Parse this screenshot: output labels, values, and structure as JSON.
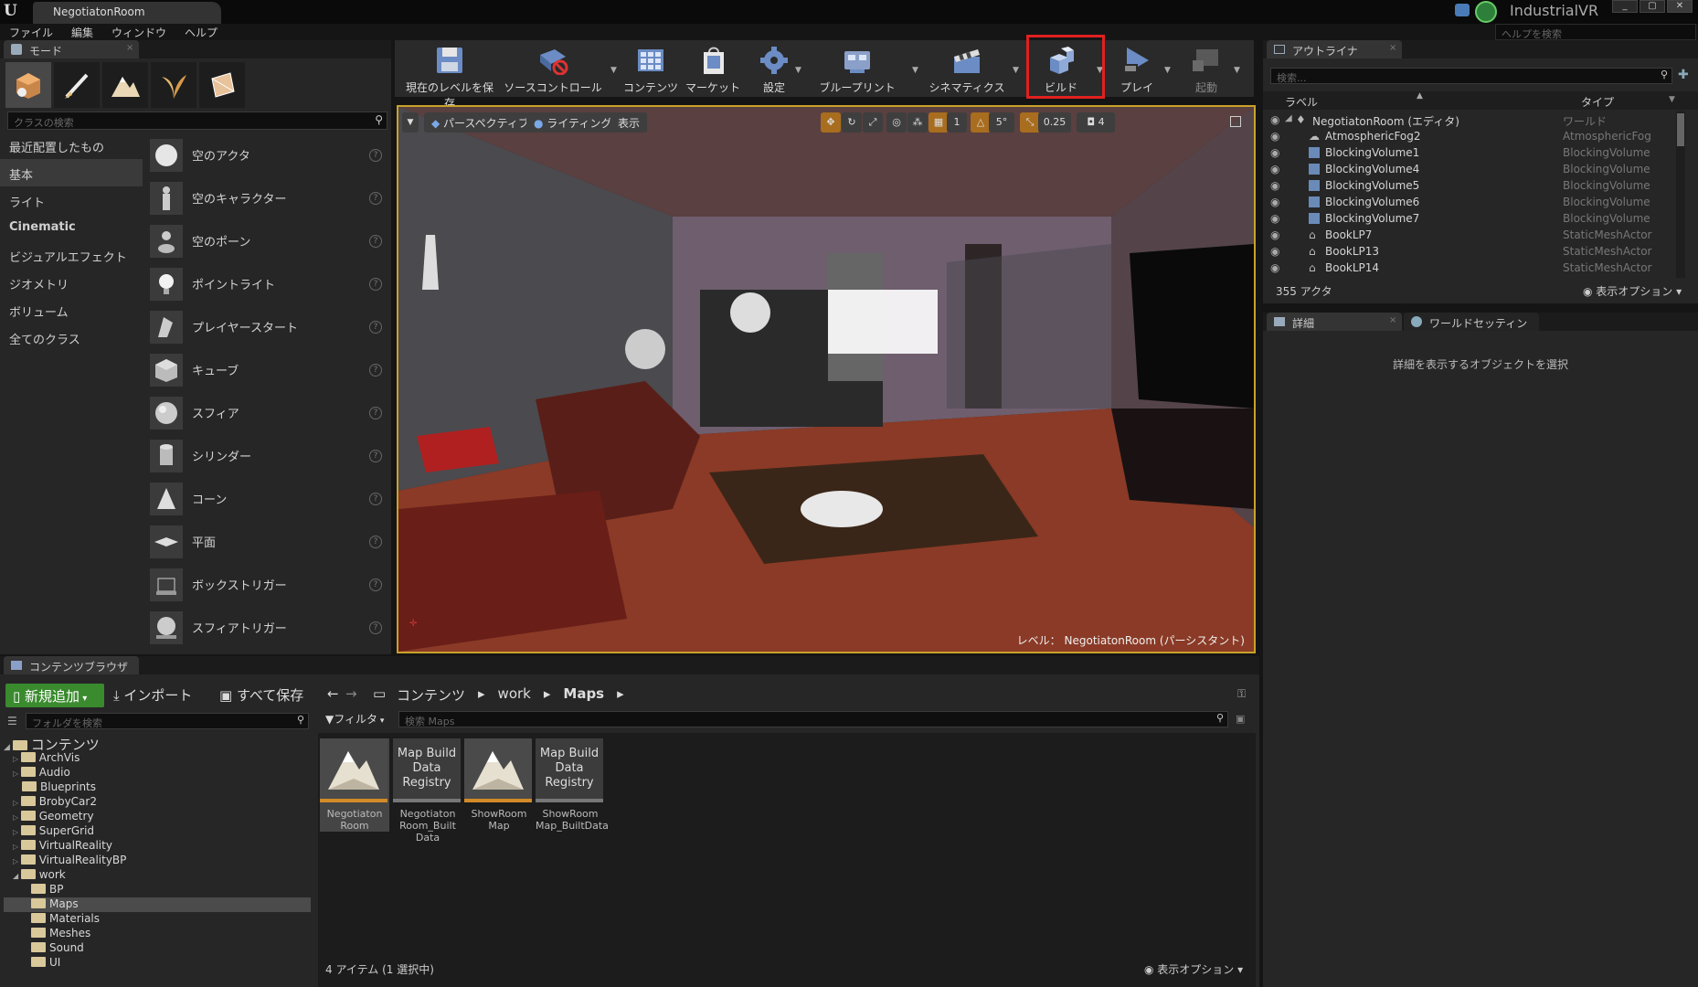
{
  "window": {
    "tab_title": "NegotiatonRoom",
    "app_title": "IndustrialVR",
    "help_search_placeholder": "ヘルプを検索"
  },
  "menu": [
    "ファイル",
    "編集",
    "ウィンドウ",
    "ヘルプ"
  ],
  "modes": {
    "tab_label": "モード",
    "search_placeholder": "クラスの検索",
    "categories": [
      "最近配置したもの",
      "基本",
      "ライト",
      "Cinematic",
      "ビジュアルエフェクト",
      "ジオメトリ",
      "ボリューム",
      "全てのクラス"
    ],
    "actors": [
      "空のアクタ",
      "空のキャラクター",
      "空のポーン",
      "ポイントライト",
      "プレイヤースタート",
      "キューブ",
      "スフィア",
      "シリンダー",
      "コーン",
      "平面",
      "ボックストリガー",
      "スフィアトリガー"
    ]
  },
  "toolbar": {
    "save_level": "現在のレベルを保存",
    "source_control": "ソースコントロール",
    "content": "コンテンツ",
    "market": "マーケット",
    "settings": "設定",
    "blueprint": "ブループリント",
    "cinematics": "シネマティクス",
    "build": "ビルド",
    "play": "プレイ",
    "launch": "起動"
  },
  "viewport": {
    "perspective": "パースペクティブ",
    "lighting": "ライティング",
    "show": "表示",
    "grid_snap": "1",
    "rotate_snap": "5°",
    "scale_snap": "0.25",
    "camera_speed": "4",
    "level_label": "レベル：",
    "level_name": "NegotiatonRoom (パーシスタント)"
  },
  "outliner": {
    "tab_label": "アウトライナ",
    "search_placeholder": "検索...",
    "col_label": "ラベル",
    "col_type": "タイプ",
    "rows": [
      {
        "name": "NegotiatonRoom (エディタ)",
        "type": "ワールド"
      },
      {
        "name": "AtmosphericFog2",
        "type": "AtmosphericFog"
      },
      {
        "name": "BlockingVolume1",
        "type": "BlockingVolume"
      },
      {
        "name": "BlockingVolume4",
        "type": "BlockingVolume"
      },
      {
        "name": "BlockingVolume5",
        "type": "BlockingVolume"
      },
      {
        "name": "BlockingVolume6",
        "type": "BlockingVolume"
      },
      {
        "name": "BlockingVolume7",
        "type": "BlockingVolume"
      },
      {
        "name": "BookLP7",
        "type": "StaticMeshActor"
      },
      {
        "name": "BookLP13",
        "type": "StaticMeshActor"
      },
      {
        "name": "BookLP14",
        "type": "StaticMeshActor"
      }
    ],
    "actor_count": "355 アクタ",
    "view_options": "表示オプション"
  },
  "details": {
    "tab_label": "詳細",
    "tab2_label": "ワールドセッティン",
    "empty_message": "詳細を表示するオブジェクトを選択"
  },
  "content_browser": {
    "tab_label": "コンテンツブラウザ",
    "add_new": "新規追加",
    "import": "インポート",
    "save_all": "すべて保存",
    "breadcrumb": [
      "コンテンツ",
      "work",
      "Maps"
    ],
    "folder_search_placeholder": "フォルダを検索",
    "filter": "フィルタ",
    "asset_search_placeholder": "検索 Maps",
    "tree": [
      {
        "label": "コンテンツ",
        "depth": 0
      },
      {
        "label": "ArchVis",
        "depth": 1
      },
      {
        "label": "Audio",
        "depth": 1
      },
      {
        "label": "Blueprints",
        "depth": 1
      },
      {
        "label": "BrobyCar2",
        "depth": 1
      },
      {
        "label": "Geometry",
        "depth": 1
      },
      {
        "label": "SuperGrid",
        "depth": 1
      },
      {
        "label": "VirtualReality",
        "depth": 1
      },
      {
        "label": "VirtualRealityBP",
        "depth": 1
      },
      {
        "label": "work",
        "depth": 1
      },
      {
        "label": "BP",
        "depth": 2
      },
      {
        "label": "Maps",
        "depth": 2
      },
      {
        "label": "Materials",
        "depth": 2
      },
      {
        "label": "Meshes",
        "depth": 2
      },
      {
        "label": "Sound",
        "depth": 2
      },
      {
        "label": "UI",
        "depth": 2
      }
    ],
    "selected_folder": "Maps",
    "assets": [
      {
        "thumb_text": "",
        "label": "Negotiaton Room",
        "kind": "map",
        "selected": true
      },
      {
        "thumb_text": "Map Build Data Registry",
        "label": "Negotiaton Room_Built Data",
        "kind": "registry",
        "selected": false
      },
      {
        "thumb_text": "",
        "label": "ShowRoom Map",
        "kind": "map",
        "selected": false
      },
      {
        "thumb_text": "Map Build Data Registry",
        "label": "ShowRoom Map_BuiltData",
        "kind": "registry",
        "selected": false
      }
    ],
    "item_count": "4 アイテム (1 選択中)",
    "view_options": "表示オプション"
  },
  "colors": {
    "build_highlight": "#e02020",
    "viewport_border": "#c9a22a",
    "add_new_bg": "#3a8a2e",
    "map_underline": "#d28b27"
  }
}
